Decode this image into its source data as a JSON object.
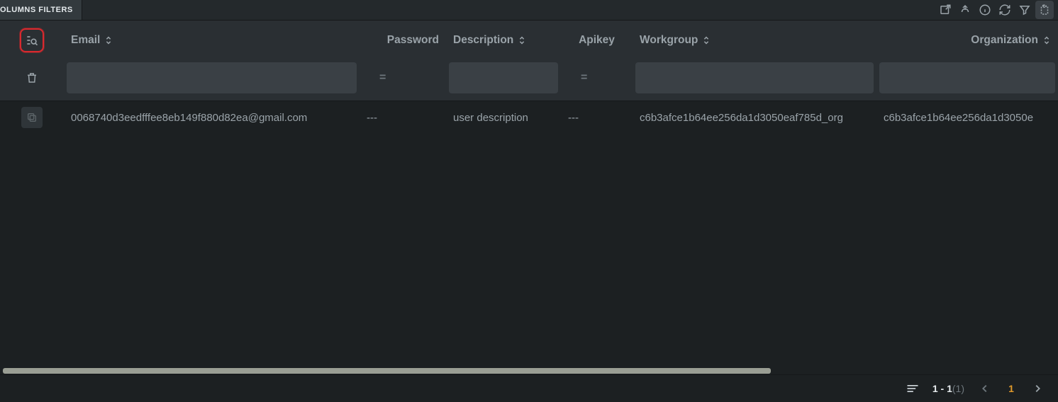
{
  "tabs": {
    "columns_filters": "OLUMNS FILTERS"
  },
  "columns": [
    {
      "key": "actions",
      "label": "",
      "sortable": false
    },
    {
      "key": "email",
      "label": "Email",
      "sortable": true
    },
    {
      "key": "password",
      "label": "Password",
      "sortable": false
    },
    {
      "key": "description",
      "label": "Description",
      "sortable": true
    },
    {
      "key": "apikey",
      "label": "Apikey",
      "sortable": false
    },
    {
      "key": "workgroup",
      "label": "Workgroup",
      "sortable": true
    },
    {
      "key": "organization",
      "label": "Organization",
      "sortable": true
    }
  ],
  "filter_operator": "=",
  "rows": [
    {
      "email": "0068740d3eedfffee8eb149f880d82ea@gmail.com",
      "password": "---",
      "description": "user description",
      "apikey": "---",
      "workgroup": "c6b3afce1b64ee256da1d3050eaf785d_org",
      "organization": "c6b3afce1b64ee256da1d3050e"
    }
  ],
  "pagination": {
    "range": "1 - 1",
    "total": "(1)",
    "page": "1"
  }
}
